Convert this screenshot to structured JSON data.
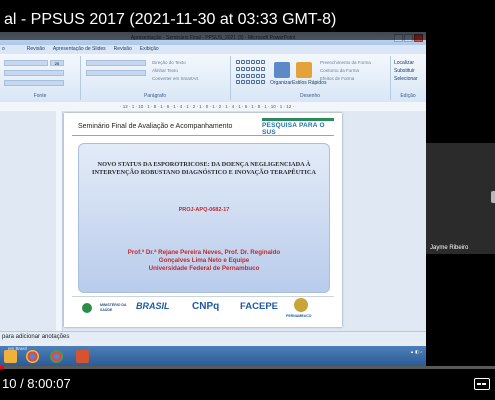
{
  "video": {
    "title": "al - PPSUS 2017 (2021-11-30 at 03:33 GMT-8)",
    "timecode": "10 / 8:00:07",
    "progress_fraction": 0.002
  },
  "ppt": {
    "window_title": "Apresentação - Seminário Final - PPSUS_2021 (3) - Microsoft PowerPoint",
    "tabs": [
      "o",
      "Revisão",
      "Apresentação de Slides",
      "Revisão",
      "Exibição"
    ],
    "ribbon": {
      "groups": [
        "Fonte",
        "Parágrafo",
        "Desenho",
        "Edição"
      ],
      "right_buttons": [
        "Localizar",
        "Substituir",
        "Selecionar"
      ],
      "faded": [
        "Direção do Texto",
        "Alinhar Texto",
        "Converter em SmartArt",
        "Preenchimento da Forma",
        "Contorno da Forma",
        "Efeitos de Forma"
      ],
      "big": [
        "Organizar",
        "Estilos Rápidos"
      ],
      "font_size": "20"
    },
    "ruler_text": "· 12 · 1 · 10 · 1 · 8 · 1 · 6 · 1 · 4 · 1 · 2 · 1 · 0 · 1 · 2 · 1 · 4 · 1 · 6 · 1 · 8 · 1 · 10 · 1 · 12 ·",
    "status_text": "para adicionar anotações",
    "taskbar_label": "em Brasil"
  },
  "slide": {
    "header": "Seminário Final de Avaliação e Acompanhamento",
    "logo_top": "PESQUISA PARA O SUS",
    "title": "NOVO STATUS DA ESPOROTRICOSE: DA DOENÇA NEGLIGENCIADA À INTERVENÇÃO ROBUSTANO DIAGNÓSTICO E INOVAÇÃO TERAPÊUTICA",
    "code": "PROJ-APQ-0682-17",
    "authors_line1": "Prof.ª Dr.ª Rejane Pereira Neves, Prof. Dr. Reginaldo",
    "authors_line2": "Gonçalves Lima Neto  e  Equipe",
    "institution": "Universidade Federal de Pernambuco",
    "logos": {
      "saude": "MINISTÉRIO DA SAÚDE",
      "brasil": "BRASIL",
      "cnpq": "CNPq",
      "facepe": "FACEPE",
      "pe": "PERNAMBUCO"
    }
  },
  "participant": {
    "name": "Jayme Ribeiro"
  },
  "colors": {
    "red": "#c0292f",
    "ribbon": "#dbe7f6",
    "taskbar": "#2b5b96"
  }
}
